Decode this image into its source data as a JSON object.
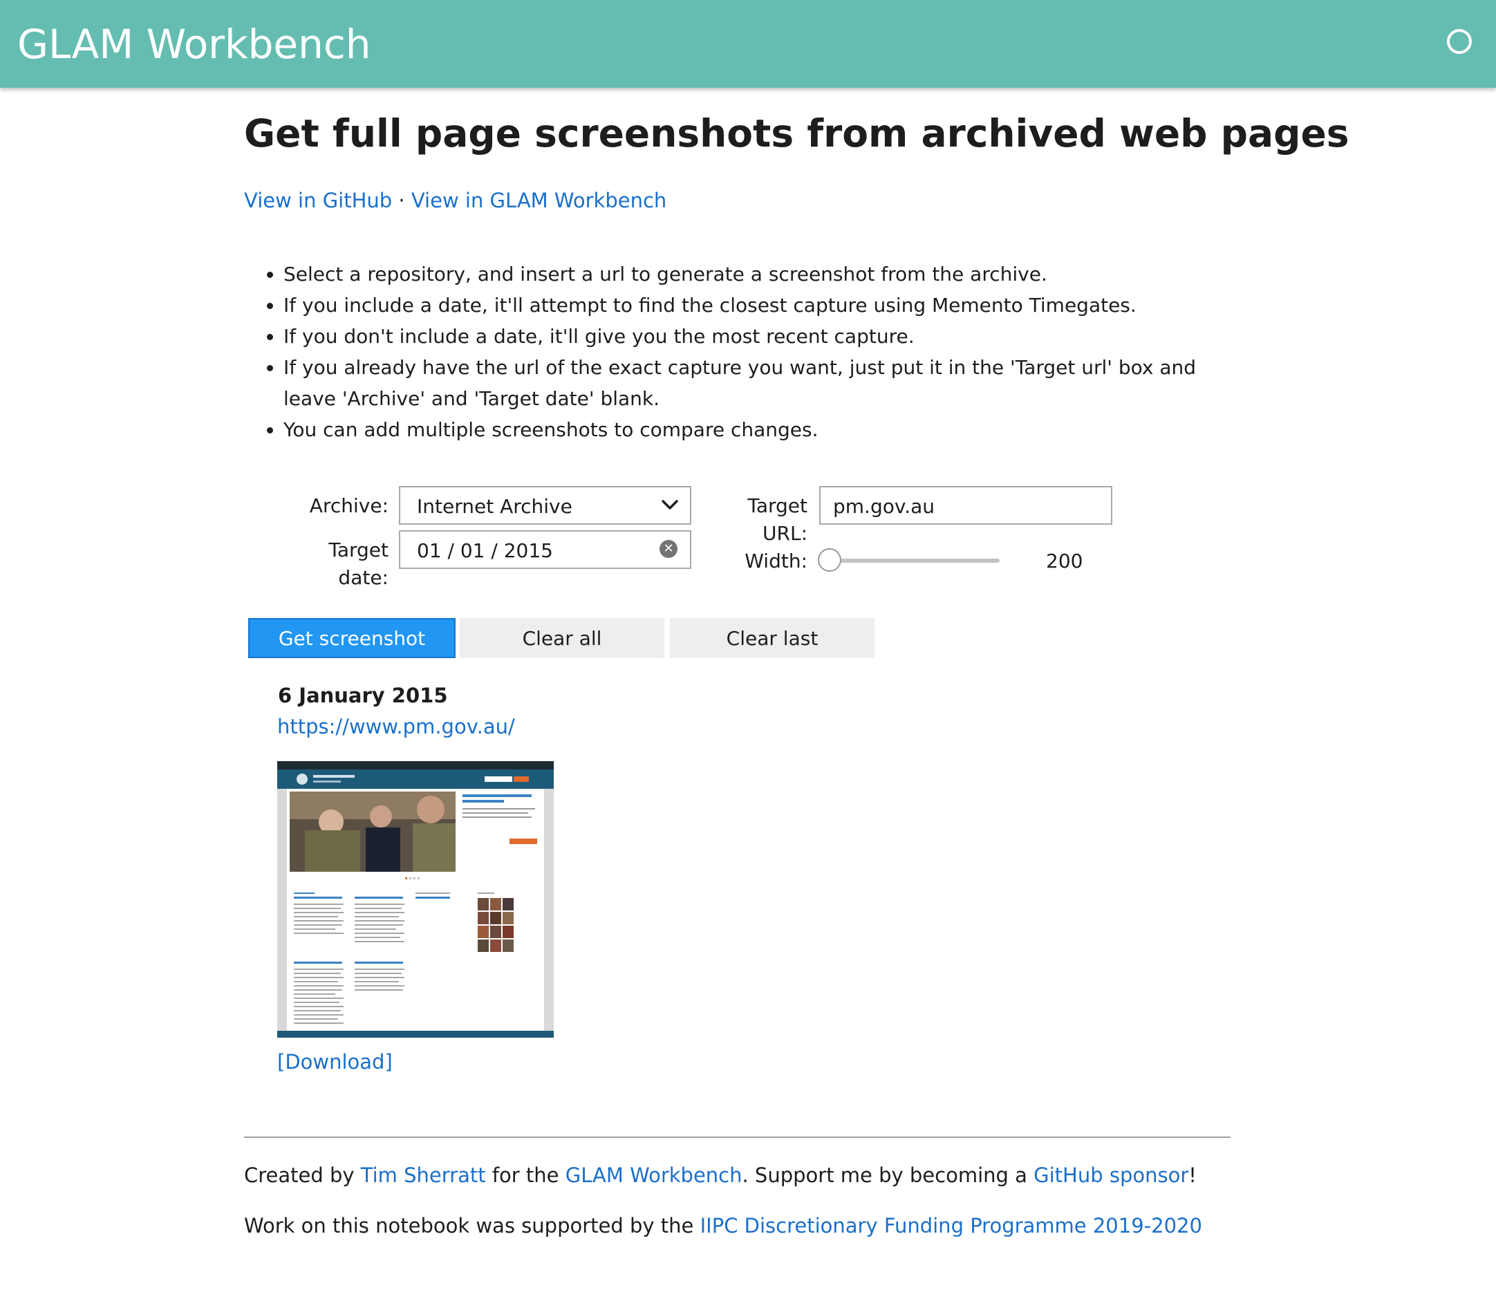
{
  "header": {
    "brand": "GLAM Workbench"
  },
  "page": {
    "title": "Get full page screenshots from archived web pages",
    "links": {
      "github": "View in GitHub",
      "separator": " · ",
      "workbench": "View in GLAM Workbench"
    },
    "instructions": [
      "Select a repository, and insert a url to generate a screenshot from the archive.",
      "If you include a date, it'll attempt to find the closest capture using Memento Timegates.",
      "If you don't include a date, it'll give you the most recent capture.",
      "If you already have the url of the exact capture you want, just put it in the 'Target url' box and leave 'Archive' and 'Target date' blank.",
      "You can add multiple screenshots to compare changes."
    ]
  },
  "form": {
    "archive_label": "Archive:",
    "archive_value": "Internet Archive",
    "target_url_label": "Target URL:",
    "target_url_value": "pm.gov.au",
    "target_date_label": "Target date:",
    "target_date_value": "01 / 01 / 2015",
    "width_label": "Width:",
    "width_value": "200"
  },
  "buttons": {
    "get_screenshot": "Get screenshot",
    "clear_all": "Clear all",
    "clear_last": "Clear last"
  },
  "result": {
    "date": "6 January 2015",
    "url": "https://www.pm.gov.au/",
    "download": "[Download]"
  },
  "footer": {
    "line1": {
      "pre": "Created by ",
      "author": "Tim Sherratt",
      "mid": " for the ",
      "workbench": "GLAM Workbench",
      "mid2": ". Support me by becoming a ",
      "sponsor": "GitHub sponsor",
      "end": "!"
    },
    "line2": {
      "pre": "Work on this notebook was supported by the ",
      "programme": "IIPC Discretionary Funding Programme 2019-2020"
    }
  },
  "colors": {
    "header_bg": "#65bdb1",
    "link": "#1a6fcc",
    "primary_button": "#2196f3",
    "grey_button": "#eeeeee"
  },
  "icons": {
    "status": "circle-icon",
    "dropdown": "chevron-down-icon",
    "clear_date": "clear-icon"
  }
}
